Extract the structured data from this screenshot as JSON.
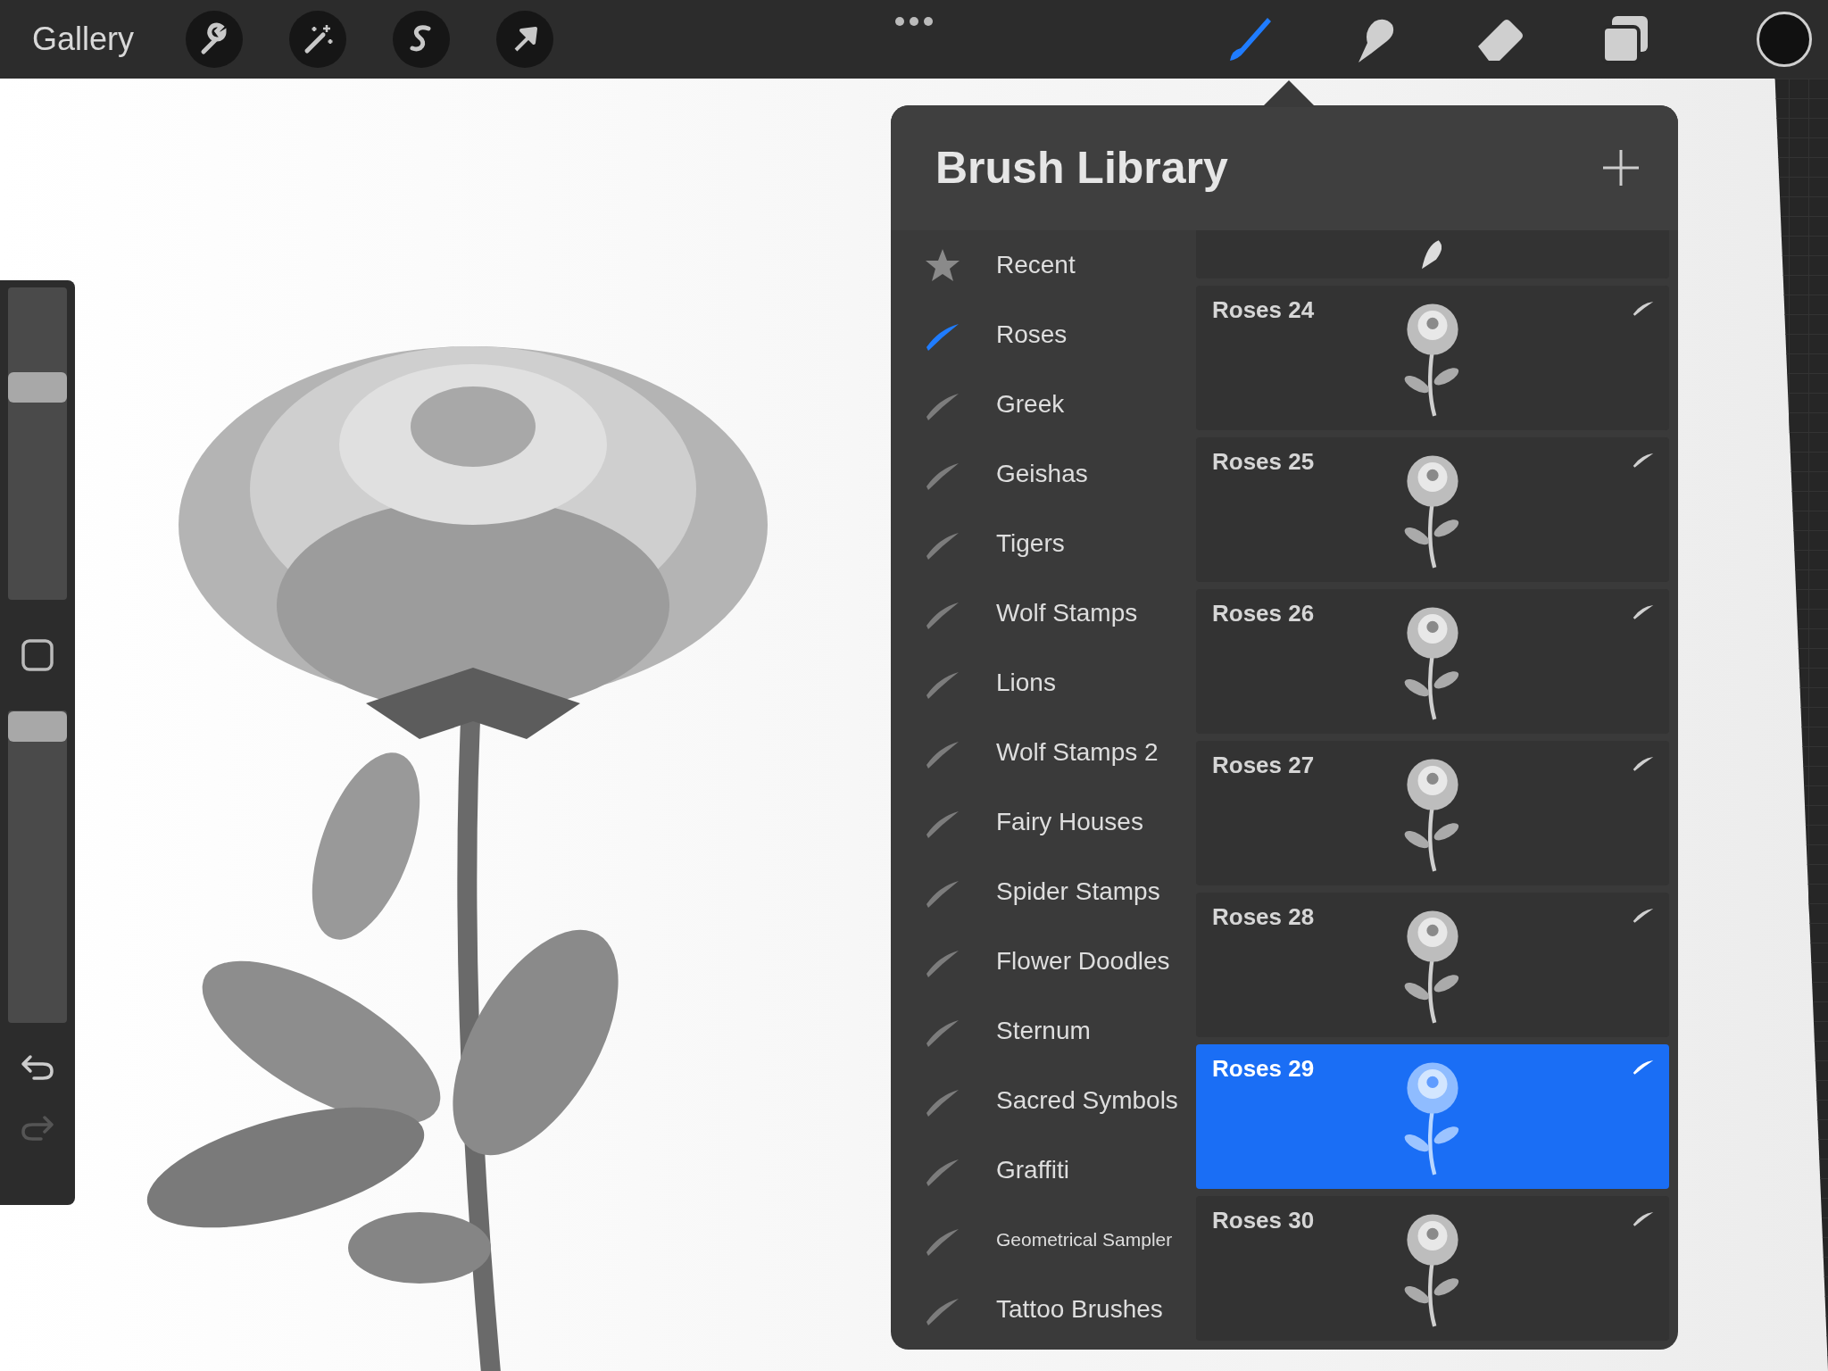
{
  "toolbar": {
    "gallery": "Gallery",
    "tools": [
      {
        "kind": "brush",
        "selected": true
      },
      {
        "kind": "smudge",
        "selected": false
      },
      {
        "kind": "eraser",
        "selected": false
      },
      {
        "kind": "layers",
        "selected": false
      }
    ]
  },
  "sidebar": {
    "brush_size": {
      "level": 0.68
    },
    "opacity": {
      "level": 0.95
    }
  },
  "brush_library": {
    "title": "Brush Library",
    "categories": [
      {
        "label": "Recent",
        "kind": "star",
        "selected": false
      },
      {
        "label": "Roses",
        "kind": "stroke",
        "selected": true
      },
      {
        "label": "Greek",
        "kind": "stroke",
        "selected": false
      },
      {
        "label": "Geishas",
        "kind": "stroke",
        "selected": false
      },
      {
        "label": "Tigers",
        "kind": "stroke",
        "selected": false
      },
      {
        "label": "Wolf Stamps",
        "kind": "stroke",
        "selected": false
      },
      {
        "label": "Lions",
        "kind": "stroke",
        "selected": false
      },
      {
        "label": "Wolf Stamps 2",
        "kind": "stroke",
        "selected": false
      },
      {
        "label": "Fairy Houses",
        "kind": "stroke",
        "selected": false
      },
      {
        "label": "Spider Stamps",
        "kind": "stroke",
        "selected": false
      },
      {
        "label": "Flower Doodles",
        "kind": "stroke",
        "selected": false
      },
      {
        "label": "Sternum",
        "kind": "stroke",
        "selected": false
      },
      {
        "label": "Sacred Symbols",
        "kind": "stroke",
        "selected": false
      },
      {
        "label": "Graffiti",
        "kind": "stroke",
        "selected": false
      },
      {
        "label": "Geometrical Sampler",
        "kind": "stroke",
        "selected": false
      },
      {
        "label": "Tattoo Brushes",
        "kind": "stroke",
        "selected": false
      }
    ],
    "brushes": [
      {
        "name": "Roses 24",
        "selected": false
      },
      {
        "name": "Roses 25",
        "selected": false
      },
      {
        "name": "Roses 26",
        "selected": false
      },
      {
        "name": "Roses 27",
        "selected": false
      },
      {
        "name": "Roses 28",
        "selected": false
      },
      {
        "name": "Roses 29",
        "selected": true
      },
      {
        "name": "Roses 30",
        "selected": false
      }
    ]
  }
}
